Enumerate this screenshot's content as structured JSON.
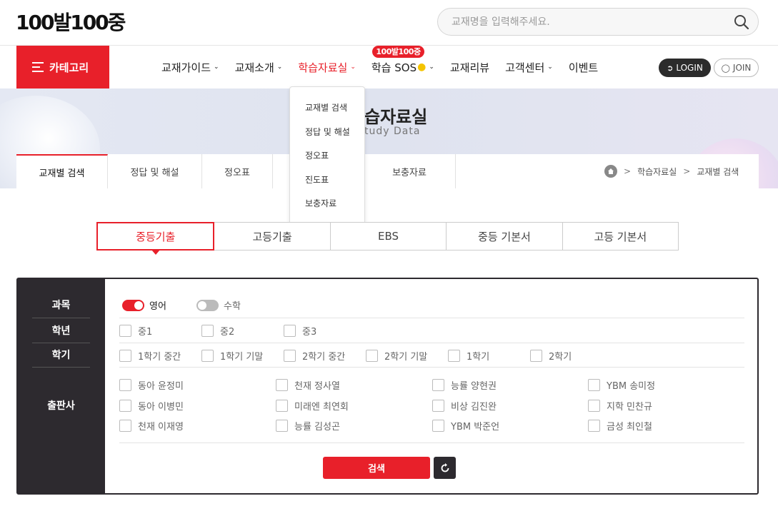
{
  "header": {
    "logo_text": "100발100중",
    "search_placeholder": "교재명을 입력해주세요."
  },
  "nav": {
    "category_label": "카테고리",
    "items": [
      {
        "label": "교재가이드",
        "chevron": true
      },
      {
        "label": "교재소개",
        "chevron": true
      },
      {
        "label": "학습자료실",
        "chevron": true,
        "active": true
      },
      {
        "label": "학습 SOS",
        "chevron": true,
        "badge": "100발100중"
      },
      {
        "label": "교재리뷰",
        "chevron": false
      },
      {
        "label": "고객센터",
        "chevron": true
      },
      {
        "label": "이벤트",
        "chevron": false
      }
    ],
    "login_label": "LOGIN",
    "join_label": "JOIN"
  },
  "dropdown": {
    "items": [
      "교재별 검색",
      "정답 및 해설",
      "정오표",
      "진도표",
      "보충자료"
    ]
  },
  "hero": {
    "title": "습자료실",
    "subtitle": "tudy Data"
  },
  "subtabs": [
    {
      "label": "교재별 검색",
      "active": true
    },
    {
      "label": "정답 및 해설"
    },
    {
      "label": "정오표"
    },
    {
      "label": ""
    },
    {
      "label": "보충자료"
    }
  ],
  "breadcrumb": {
    "sep": ">",
    "items": [
      "학습자료실",
      "교재별 검색"
    ]
  },
  "category_tabs": [
    {
      "label": "중등기출",
      "active": true
    },
    {
      "label": "고등기출"
    },
    {
      "label": "EBS"
    },
    {
      "label": "중등 기본서"
    },
    {
      "label": "고등 기본서"
    }
  ],
  "filter": {
    "labels": {
      "subject": "과목",
      "grade": "학년",
      "semester": "학기",
      "publisher": "출판사"
    },
    "subjects": [
      {
        "label": "영어",
        "on": true
      },
      {
        "label": "수학",
        "on": false
      }
    ],
    "grades": [
      "중1",
      "중2",
      "중3"
    ],
    "semesters": [
      "1학기 중간",
      "1학기 기말",
      "2학기 중간",
      "2학기 기말",
      "1학기",
      "2학기"
    ],
    "publishers": [
      [
        "동아 윤정미",
        "천재 정사열",
        "능률 양현권",
        "YBM 송미정"
      ],
      [
        "동아 이병민",
        "미래엔 최연회",
        "비상 김진완",
        "지학 민찬규"
      ],
      [
        "천재 이재영",
        "능률 김성곤",
        "YBM 박준언",
        "금성 최인철"
      ]
    ],
    "search_label": "검색"
  },
  "colors": {
    "accent": "#e8202a",
    "dark": "#2d2a2f"
  }
}
